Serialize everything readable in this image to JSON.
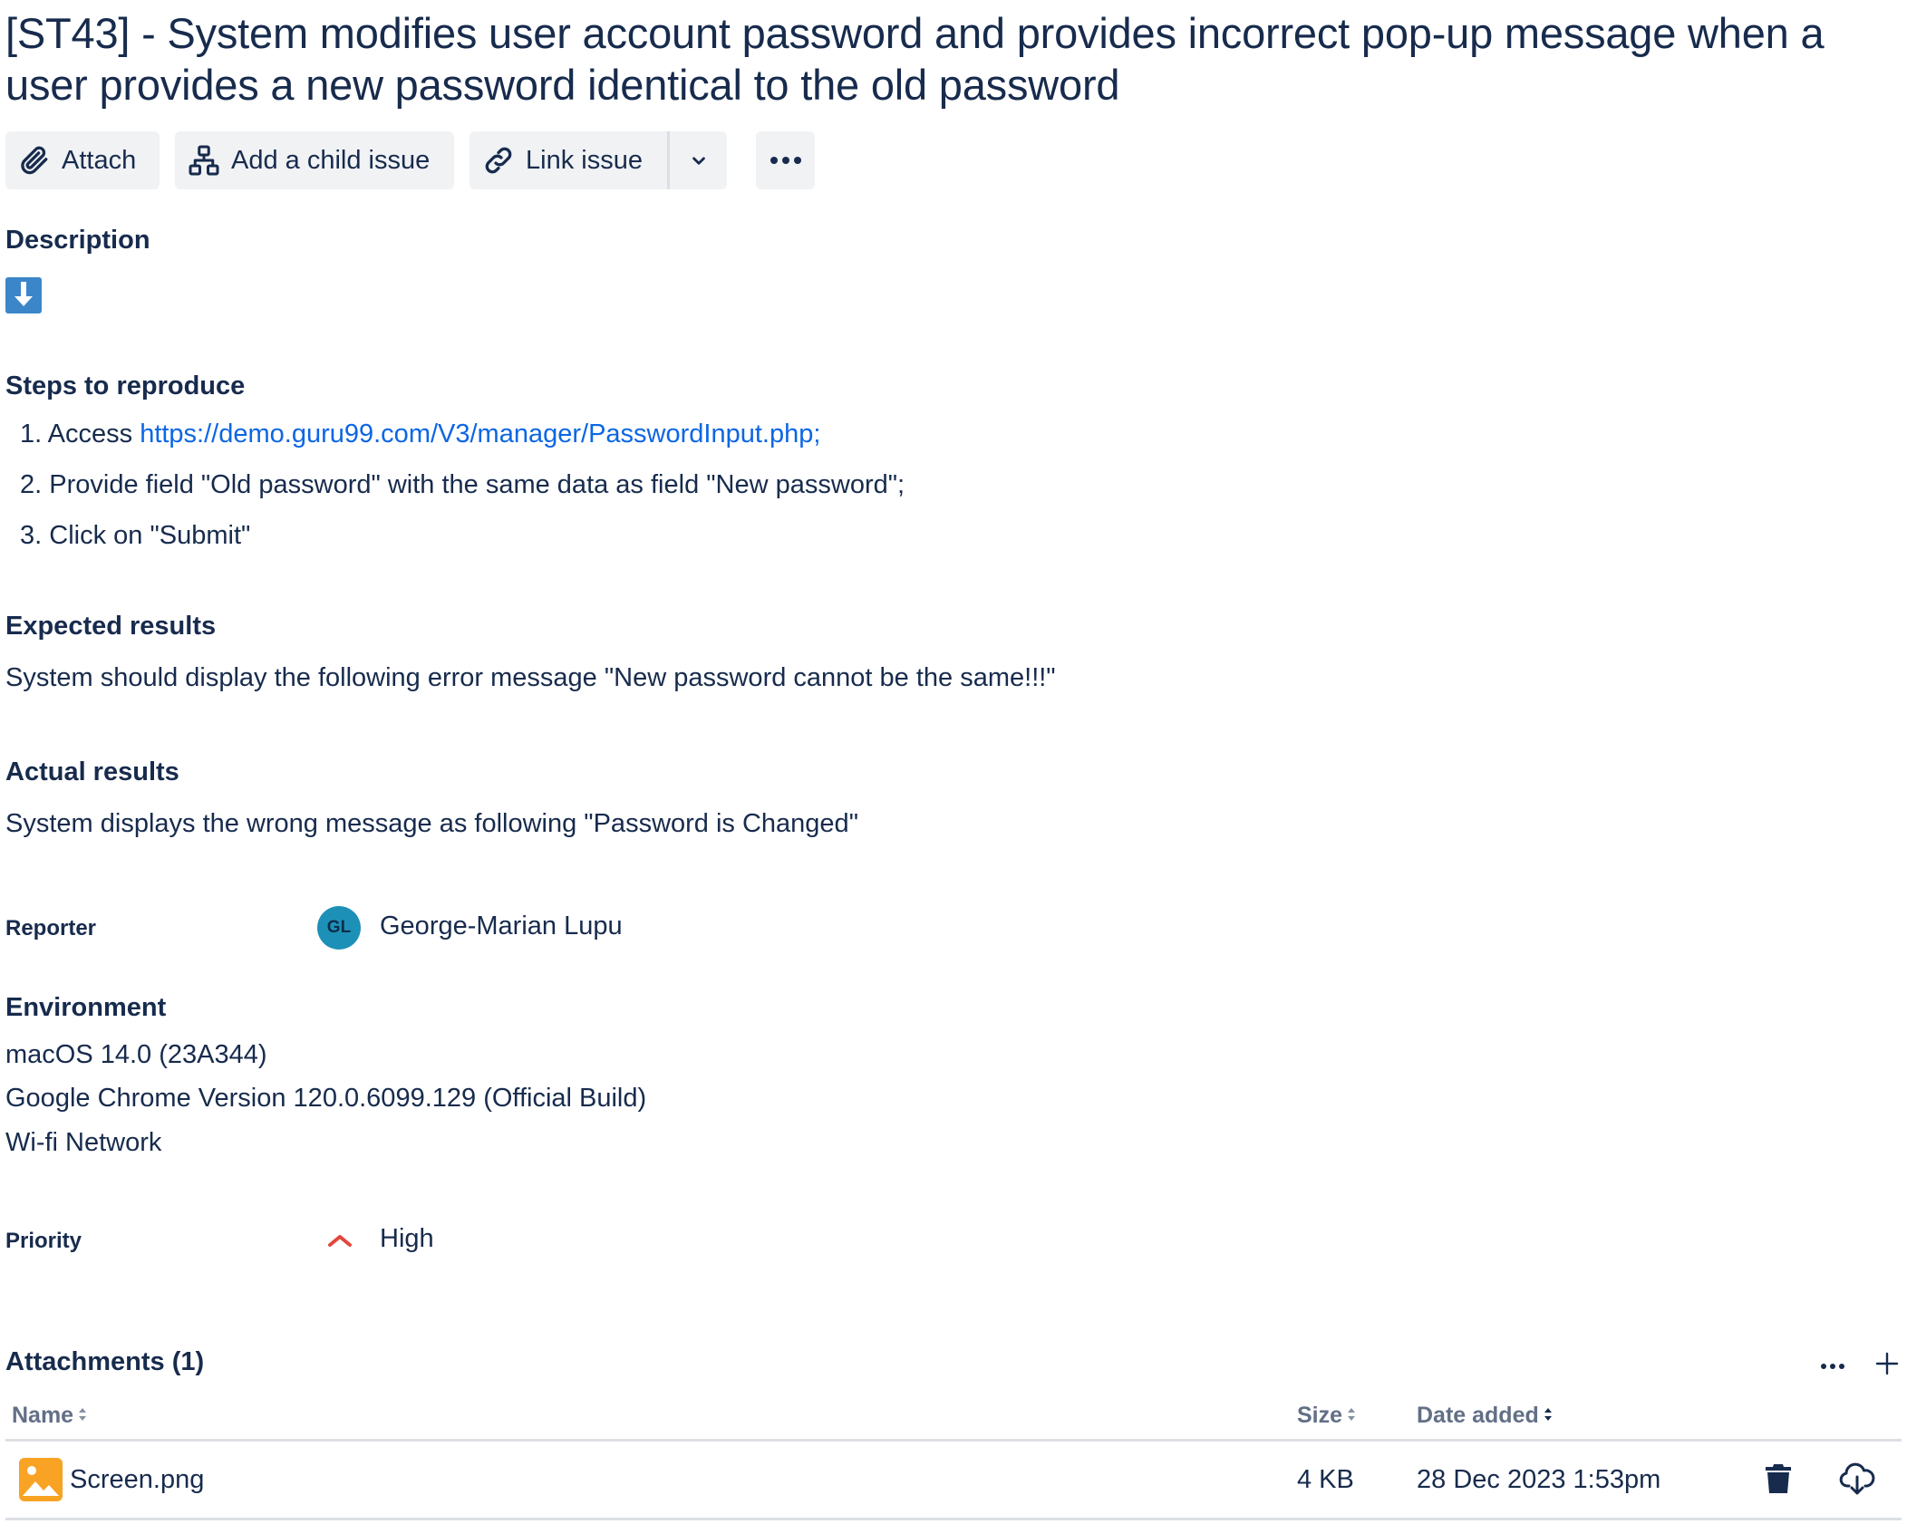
{
  "issue": {
    "title": "[ST43] - System modifies user account password and provides incorrect pop-up message when a user provides a new password identical to the old password"
  },
  "toolbar": {
    "attach_label": "Attach",
    "child_label": "Add a child issue",
    "link_label": "Link issue"
  },
  "description": {
    "heading": "Description",
    "steps_heading": "Steps to reproduce",
    "steps": [
      {
        "num": "1.",
        "prefix": "Access ",
        "link": "https://demo.guru99.com/V3/manager/PasswordInput.php;"
      },
      {
        "num": "2.",
        "text": "Provide field \"Old password\" with the same data as field \"New password\";"
      },
      {
        "num": "3.",
        "text": "Click on \"Submit\""
      }
    ],
    "expected_heading": "Expected results",
    "expected_text": "System should display the following error message \"New password cannot be the same!!!\"",
    "actual_heading": "Actual results",
    "actual_text": "System displays the wrong message as following \"Password is Changed\""
  },
  "reporter": {
    "label": "Reporter",
    "initials": "GL",
    "name": "George-Marian Lupu",
    "avatar_color": "#1d90b8"
  },
  "environment": {
    "heading": "Environment",
    "lines": [
      "macOS 14.0 (23A344)",
      "Google Chrome Version 120.0.6099.129 (Official Build)",
      "Wi-fi Network"
    ]
  },
  "priority": {
    "label": "Priority",
    "value": "High",
    "icon": "priority-high-icon",
    "color": "#e2483d"
  },
  "attachments": {
    "heading": "Attachments (1)",
    "columns": {
      "name": "Name",
      "size": "Size",
      "date": "Date added"
    },
    "rows": [
      {
        "name": "Screen.png",
        "size": "4 KB",
        "date": "28 Dec 2023 1:53pm"
      }
    ]
  },
  "colors": {
    "text": "#172b4d",
    "link": "#0c66e4",
    "button_bg": "#f1f2f4",
    "muted": "#626f86",
    "image_icon": "#f8a323",
    "download_icon": "#2b7bd1"
  }
}
